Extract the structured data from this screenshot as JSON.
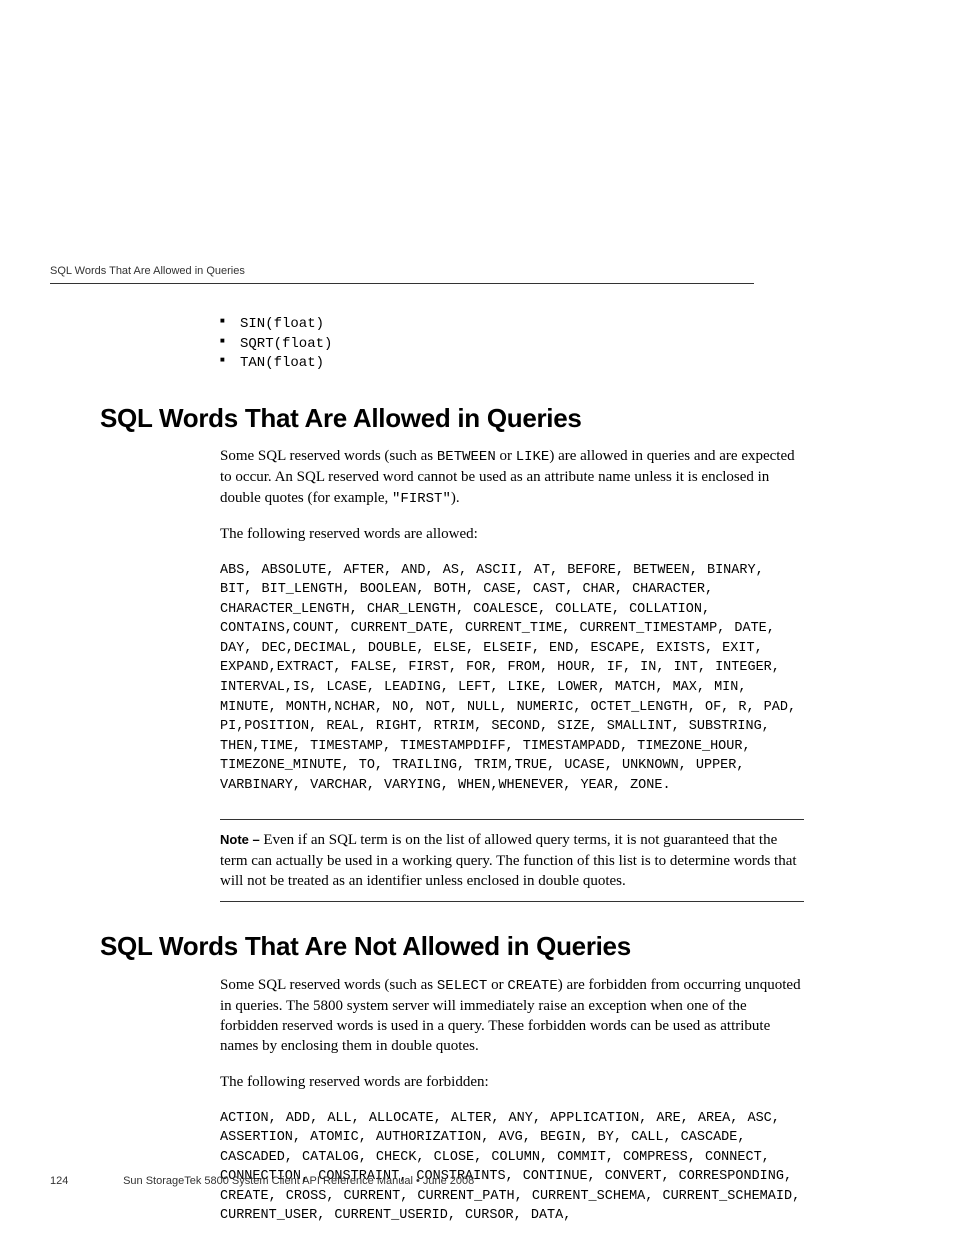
{
  "running_head": "SQL Words That Are Allowed in Queries",
  "functions": [
    "SIN(float)",
    "SQRT(float)",
    "TAN(float)"
  ],
  "section1": {
    "title": "SQL Words That Are Allowed in Queries",
    "para1_pre": "Some SQL reserved words (such as ",
    "para1_kw1": "BETWEEN",
    "para1_mid1": " or ",
    "para1_kw2": "LIKE",
    "para1_post": ") are allowed in queries and are expected to occur. An SQL reserved word cannot be used as an attribute name unless it is enclosed in double quotes (for example, ",
    "para1_kw3": "\"FIRST\"",
    "para1_end": ").",
    "para2": "The following reserved words are allowed:",
    "reserved": "ABS, ABSOLUTE, AFTER, AND, AS, ASCII, AT, BEFORE, BETWEEN, BINARY, BIT, BIT_LENGTH, BOOLEAN, BOTH, CASE, CAST, CHAR, CHARACTER, CHARACTER_LENGTH, CHAR_LENGTH, COALESCE, COLLATE, COLLATION, CONTAINS,COUNT, CURRENT_DATE, CURRENT_TIME, CURRENT_TIMESTAMP, DATE, DAY, DEC,DECIMAL, DOUBLE, ELSE, ELSEIF, END, ESCAPE, EXISTS, EXIT, EXPAND,EXTRACT, FALSE, FIRST, FOR, FROM, HOUR, IF, IN, INT, INTEGER, INTERVAL,IS, LCASE, LEADING, LEFT, LIKE, LOWER, MATCH, MAX, MIN, MINUTE, MONTH,NCHAR, NO, NOT, NULL, NUMERIC, OCTET_LENGTH, OF, R, PAD, PI,POSITION, REAL, RIGHT, RTRIM, SECOND, SIZE, SMALLINT, SUBSTRING, THEN,TIME, TIMESTAMP, TIMESTAMPDIFF, TIMESTAMPADD, TIMEZONE_HOUR, TIMEZONE_MINUTE, TO, TRAILING, TRIM,TRUE, UCASE, UNKNOWN, UPPER, VARBINARY, VARCHAR, VARYING, WHEN,WHENEVER, YEAR, ZONE.",
    "note_label": "Note – ",
    "note_text": "Even if an SQL term is on the list of allowed query terms, it is not guaranteed that the term can actually be used in a working query. The function of this list is to determine words that will not be treated as an identifier unless enclosed in double quotes."
  },
  "section2": {
    "title": "SQL Words That Are Not Allowed in Queries",
    "para1_pre": "Some SQL reserved words (such as ",
    "para1_kw1": "SELECT",
    "para1_mid1": " or ",
    "para1_kw2": "CREATE",
    "para1_post": ") are forbidden from occurring unquoted in queries. The 5800 system server will immediately raise an exception when one of the forbidden reserved words is used in a query. These forbidden words can be used as attribute names by enclosing them in double quotes.",
    "para2": "The following reserved words are forbidden:",
    "reserved": "ACTION, ADD, ALL, ALLOCATE, ALTER, ANY, APPLICATION, ARE, AREA, ASC, ASSERTION, ATOMIC, AUTHORIZATION, AVG, BEGIN, BY, CALL, CASCADE, CASCADED, CATALOG, CHECK, CLOSE, COLUMN, COMMIT, COMPRESS, CONNECT, CONNECTION, CONSTRAINT, CONSTRAINTS, CONTINUE, CONVERT, CORRESPONDING, CREATE, CROSS, CURRENT, CURRENT_PATH, CURRENT_SCHEMA, CURRENT_SCHEMAID, CURRENT_USER, CURRENT_USERID, CURSOR, DATA,"
  },
  "footer": {
    "page": "124",
    "text": "Sun StorageTek 5800 System Client API Reference Manual • June 2008"
  }
}
